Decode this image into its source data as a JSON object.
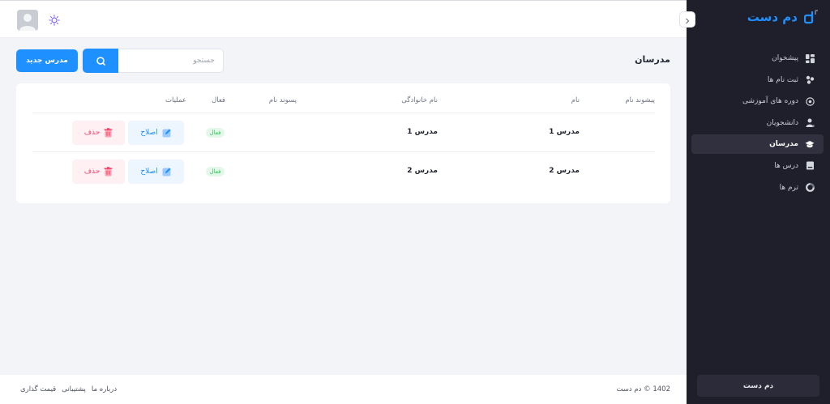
{
  "app": {
    "brand": "دم دست"
  },
  "header": {
    "avatar_icon": "user-avatar-icon",
    "theme_icon": "sun-icon"
  },
  "sidebar": {
    "items": [
      {
        "label": "پیشخوان",
        "icon": "dashboard-icon",
        "active": false
      },
      {
        "label": "ثبت نام ها",
        "icon": "registrations-icon",
        "active": false
      },
      {
        "label": "دوره های آموزشی",
        "icon": "courses-icon",
        "active": false
      },
      {
        "label": "دانشجویان",
        "icon": "students-icon",
        "active": false
      },
      {
        "label": "مدرسان",
        "icon": "teachers-icon",
        "active": true
      },
      {
        "label": "درس ها",
        "icon": "lessons-icon",
        "active": false
      },
      {
        "label": "ترم ها",
        "icon": "terms-icon",
        "active": false
      }
    ],
    "footer_button": "دم دست"
  },
  "page": {
    "title": "مدرسان",
    "search_placeholder": "جستجو",
    "new_button": "مدرس جدید"
  },
  "table": {
    "headers": {
      "prefix": "پیشوند نام",
      "name": "نام",
      "lastname": "نام خانوادگی",
      "suffix": "پسوند نام",
      "active": "فعال",
      "actions": "عملیات"
    },
    "rows": [
      {
        "prefix": "",
        "name": "مدرس 1",
        "lastname": "مدرس 1",
        "suffix": "",
        "status": "فعال",
        "edit": "اصلاح",
        "delete": "حذف"
      },
      {
        "prefix": "",
        "name": "مدرس 2",
        "lastname": "مدرس 2",
        "suffix": "",
        "status": "فعال",
        "edit": "اصلاح",
        "delete": "حذف"
      }
    ]
  },
  "footer": {
    "copyright": "1402 © دم دست",
    "links": [
      "درباره ما",
      "پشتیبانی",
      "قیمت گذاری"
    ]
  },
  "colors": {
    "primary": "#1e90ff",
    "sidebar": "#1f1e2b",
    "success": "#2fbf5b",
    "danger": "#f0466a"
  }
}
